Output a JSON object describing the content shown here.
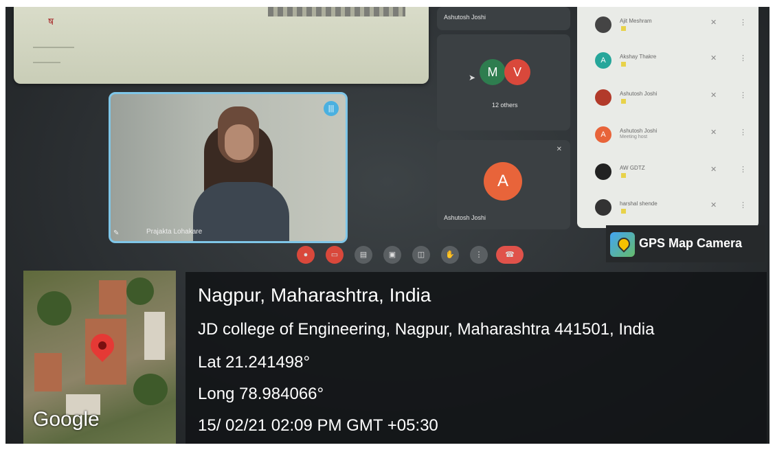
{
  "meeting": {
    "top_tile_name": "Ashutosh Joshi",
    "group_tile": {
      "avatar1": "M",
      "avatar2": "V",
      "others_text": "12 others"
    },
    "speaker_tile": {
      "avatar": "A",
      "name": "Ashutosh Joshi"
    },
    "self_tile_name": "Prajakta Lohakare",
    "participants": [
      {
        "name": "Ajit Meshram",
        "initial": "",
        "color": "#444444"
      },
      {
        "name": "Akshay Thakre",
        "initial": "A",
        "color": "#26a69a"
      },
      {
        "name": "Ashutosh Joshi",
        "initial": "",
        "color": "#b23a2a"
      },
      {
        "name": "Ashutosh Joshi",
        "sub": "Meeting host",
        "initial": "A",
        "color": "#e8643a"
      },
      {
        "name": "AW GDTZ",
        "initial": "",
        "color": "#222222"
      },
      {
        "name": "harshal shende",
        "initial": "",
        "color": "#333333"
      }
    ],
    "colors": {
      "m_avatar": "#2e7d4f",
      "v_avatar": "#d9483b",
      "a_avatar": "#e8643a",
      "end_call": "#e0524a"
    }
  },
  "gps": {
    "app_label": "GPS Map Camera",
    "map_label": "Google",
    "city": "Nagpur, Maharashtra, India",
    "address": "JD college of Engineering, Nagpur, Maharashtra 441501, India",
    "lat": "Lat 21.241498°",
    "long": "Long 78.984066°",
    "datetime": "15/ 02/21 02:09 PM GMT +05:30"
  }
}
